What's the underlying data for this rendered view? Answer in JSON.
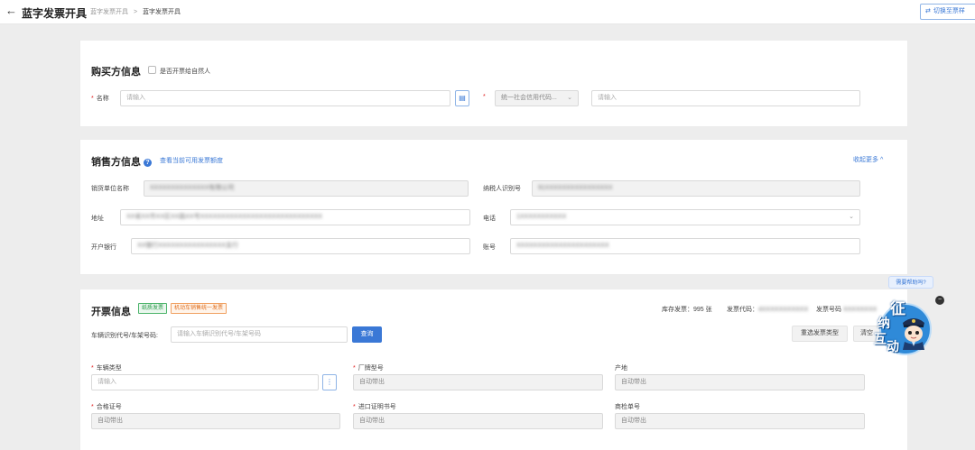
{
  "header": {
    "back_glyph": "←",
    "title": "蓝字发票开具",
    "breadcrumb": [
      "蓝字发票开具",
      "蓝字发票开具"
    ],
    "breadcrumb_sep": ">",
    "switch_label": "切换至票样"
  },
  "buyer": {
    "title": "购买方信息",
    "natural_person_label": "是否开票给自然人",
    "name_label": "名称",
    "name_placeholder": "请输入",
    "taxid_type_value": "统一社会信用代码...",
    "taxid_placeholder": "请输入",
    "required_mark": "*"
  },
  "seller": {
    "title": "销售方信息",
    "help_glyph": "?",
    "view_quota_link": "查看当前可用发票额度",
    "collapse_link": "收起更多",
    "collapse_glyph": "^",
    "name_label": "销货单位名称",
    "name_value": "XXXXXXXXXXXXXX有限公司",
    "taxid_label": "纳税人识别号",
    "taxid_value": "91XXXXXXXXXXXXXXXX",
    "address_label": "地址",
    "address_value": "XX省XX市XX区XX路XX号XXXXXXXXXXXXXXXXXXXXXXXXXXXXX",
    "phone_label": "电话",
    "phone_value": "1XXXXXXXXXXX",
    "bank_label": "开户银行",
    "bank_value": "XX银行XXXXXXXXXXXXXXXX支行",
    "account_label": "账号",
    "account_value": "XXXXXXXXXXXXXXXXXXXXXX"
  },
  "issue": {
    "title": "开票信息",
    "tag_green": "纸质发票",
    "tag_orange": "机动车销售统一发票",
    "stock_label": "库存发票：995 张",
    "code_label": "发票代码：",
    "code_value": "4XXXXXXXXXXX",
    "number_label": "发票号码",
    "number_value": "XXXXXXXX",
    "vin_label": "车辆识别代号/车架号码:",
    "vin_placeholder": "请输入车辆识别代号/车架号码",
    "query_button": "查询",
    "reselect_button": "重选发票类型",
    "clear_button": "清空",
    "vehicle_type_label": "车辆类型",
    "vehicle_type_placeholder": "请输入",
    "more_glyph": "⋮",
    "model_label": "厂牌型号",
    "model_placeholder": "自动带出",
    "origin_label": "产地",
    "origin_placeholder": "自动带出",
    "cert_label": "合格证号",
    "cert_placeholder": "自动带出",
    "import_label": "进口证明书号",
    "import_placeholder": "自动带出",
    "inspection_label": "商检单号",
    "inspection_placeholder": "自动带出"
  },
  "assistant": {
    "tip": "需要帮助吗?",
    "close_glyph": "−",
    "chars": [
      "征",
      "纳",
      "互",
      "动"
    ]
  }
}
